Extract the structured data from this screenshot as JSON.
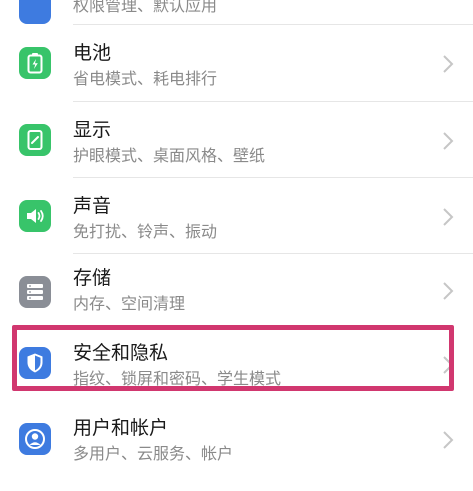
{
  "accent_highlight": "#d1376f",
  "items": [
    {
      "title": "",
      "subtitle": "权限管理、默认应用",
      "icon": "apps-icon",
      "color": "#3e7be0"
    },
    {
      "title": "电池",
      "subtitle": "省电模式、耗电排行",
      "icon": "battery-icon",
      "color": "#38c46a"
    },
    {
      "title": "显示",
      "subtitle": "护眼模式、桌面风格、壁纸",
      "icon": "display-icon",
      "color": "#38c46a"
    },
    {
      "title": "声音",
      "subtitle": "免打扰、铃声、振动",
      "icon": "sound-icon",
      "color": "#38c46a"
    },
    {
      "title": "存储",
      "subtitle": "内存、空间清理",
      "icon": "storage-icon",
      "color": "#8a8e96"
    },
    {
      "title": "安全和隐私",
      "subtitle": "指纹、锁屏和密码、学生模式",
      "icon": "shield-icon",
      "color": "#3e7be0"
    },
    {
      "title": "用户和帐户",
      "subtitle": "多用户、云服务、帐户",
      "icon": "user-account-icon",
      "color": "#3e7be0"
    }
  ]
}
